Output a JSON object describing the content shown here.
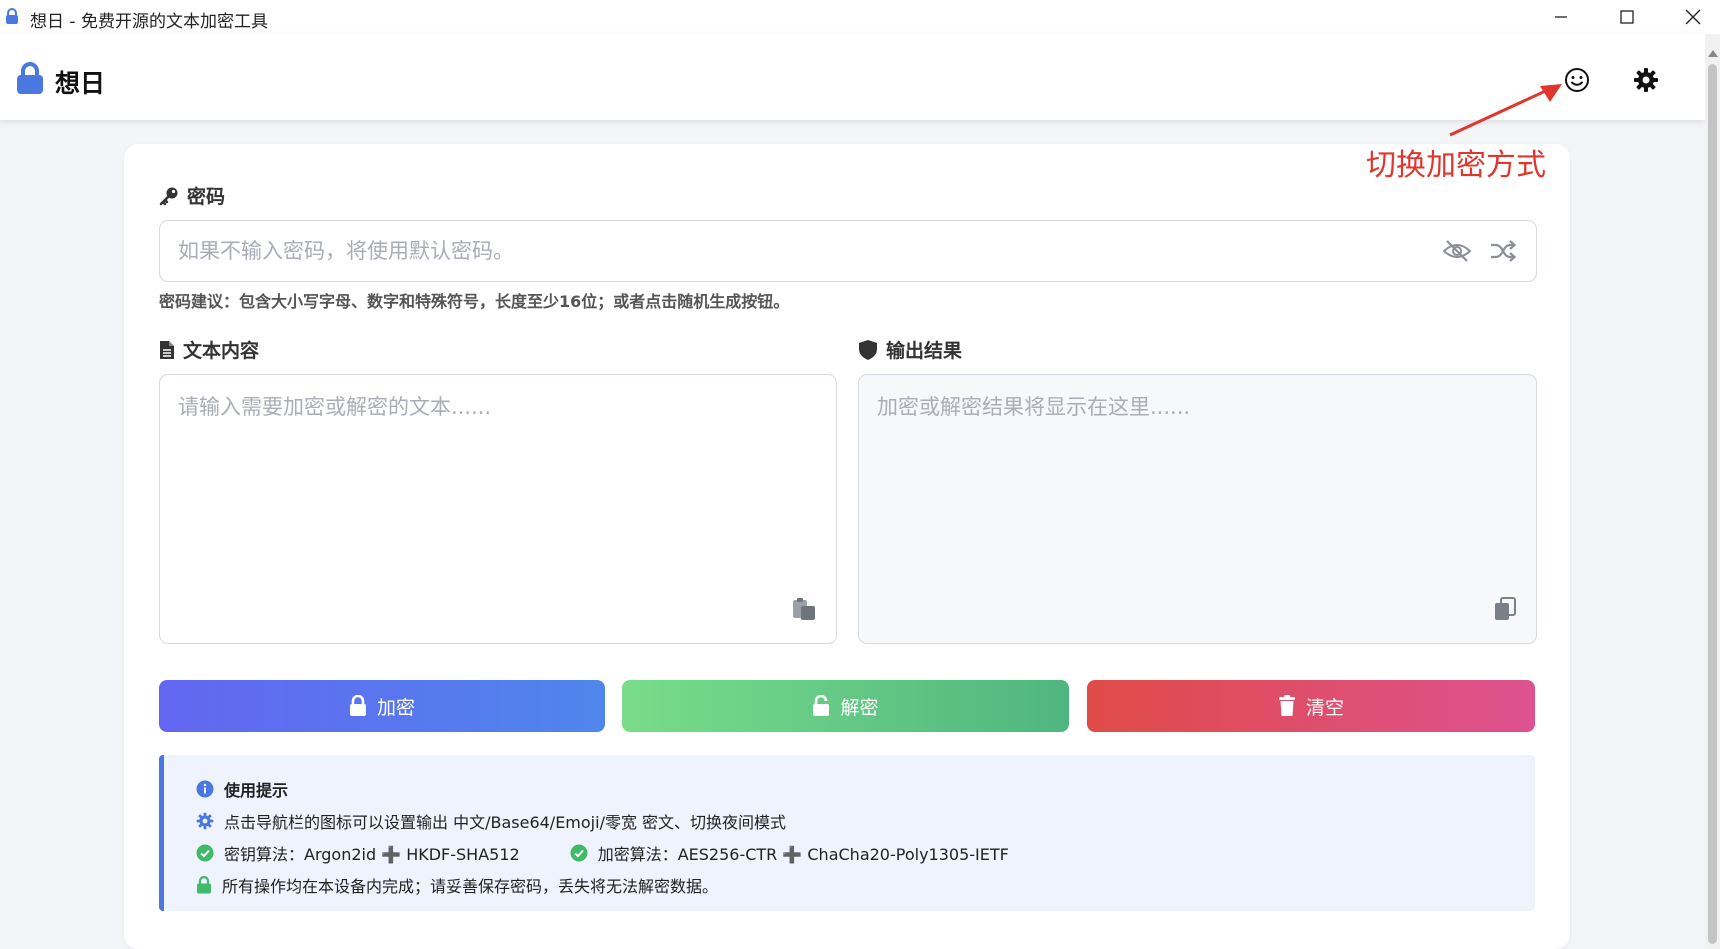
{
  "window": {
    "title": "想日 - 免费开源的文本加密工具"
  },
  "header": {
    "brand": "想日"
  },
  "annotation": {
    "text": "切换加密方式"
  },
  "password": {
    "label": "密码",
    "placeholder": "如果不输入密码，将使用默认密码。",
    "hint": "密码建议：包含大小写字母、数字和特殊符号，长度至少16位；或者点击随机生成按钮。"
  },
  "input_text": {
    "label": "文本内容",
    "placeholder": "请输入需要加密或解密的文本......"
  },
  "output_text": {
    "label": "输出结果",
    "placeholder": "加密或解密结果将显示在这里......"
  },
  "actions": {
    "encrypt": "加密",
    "decrypt": "解密",
    "clear": "清空"
  },
  "tips": {
    "title": "使用提示",
    "line1": "点击导航栏的图标可以设置输出 中文/Base64/Emoji/零宽 密文、切换夜间模式",
    "key_algo": "密钥算法：Argon2id ➕ HKDF-SHA512",
    "enc_algo": "加密算法：AES256-CTR ➕ ChaCha20-Poly1305-IETF",
    "line3": "所有操作均在本设备内完成；请妥善保存密码，丢失将无法解密数据。"
  },
  "colors": {
    "encrypt_gradient": [
      "#6366f1",
      "#4f86ec"
    ],
    "decrypt_gradient": [
      "#79dc8a",
      "#4fb67f"
    ],
    "clear_gradient": [
      "#e04b48",
      "#dd5290"
    ],
    "annotation": "#e0362c",
    "accent": "#4a78e0"
  }
}
